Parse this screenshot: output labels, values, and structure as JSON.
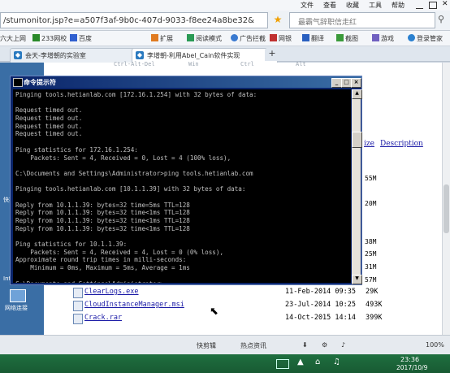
{
  "browser": {
    "menu": [
      "文件",
      "查看",
      "收藏",
      "工具",
      "帮助"
    ],
    "url": "/stumonitor.jsp?e=a507f3af-9b0c-407d-9033-f8ee24a8be32&",
    "search_placeholder": "最霸气辞职信走红",
    "favorites_left": [
      "六大上网",
      "233网校",
      "百度"
    ],
    "toolbar_right": [
      "扩展",
      "阅读模式",
      "广告拦截",
      "网银",
      "翻译",
      "截图",
      "游戏",
      "登录管家"
    ],
    "tabs": [
      {
        "label": "会天-李增朝的实验室",
        "active": false
      },
      {
        "label": "李增朝-利用Abel_Cain软件实现",
        "active": true
      }
    ],
    "shortcut_hints": [
      "Ctrl-Alt-Del",
      "Win",
      "Ctrl",
      "Alt"
    ]
  },
  "page": {
    "header_links": [
      "ize",
      "Description"
    ],
    "desktop_items": [
      "快捷",
      "网络连接",
      "Int"
    ]
  },
  "cmd": {
    "title": "命令提示符",
    "lines": [
      "Pinging tools.hetianlab.com [172.16.1.254] with 32 bytes of data:",
      "",
      "Request timed out.",
      "Request timed out.",
      "Request timed out.",
      "Request timed out.",
      "",
      "Ping statistics for 172.16.1.254:",
      "    Packets: Sent = 4, Received = 0, Lost = 4 (100% loss),",
      "",
      "C:\\Documents and Settings\\Administrator>ping tools.hetianlab.com",
      "",
      "Pinging tools.hetianlab.com [10.1.1.39] with 32 bytes of data:",
      "",
      "Reply from 10.1.1.39: bytes=32 time=5ms TTL=128",
      "Reply from 10.1.1.39: bytes=32 time<1ms TTL=128",
      "Reply from 10.1.1.39: bytes=32 time<1ms TTL=128",
      "Reply from 10.1.1.39: bytes=32 time<1ms TTL=128",
      "",
      "Ping statistics for 10.1.1.39:",
      "    Packets: Sent = 4, Received = 4, Lost = 0 (0% loss),",
      "Approximate round trip times in milli-seconds:",
      "    Minimum = 0ms, Maximum = 5ms, Average = 1ms",
      "",
      "C:\\Documents and Settings\\Administrator>_"
    ]
  },
  "files": [
    {
      "name": "ClearLogs.exe",
      "date": "11-Feb-2014 09:35",
      "size": "29K"
    },
    {
      "name": "CloudInstanceManager.msi",
      "date": "23-Jul-2014 10:25",
      "size": "493K"
    },
    {
      "name": "Crack.rar",
      "date": "14-Oct-2015 14:14",
      "size": "399K"
    }
  ],
  "side_sizes": [
    "55M",
    "20M",
    "38M",
    "25M",
    "31M",
    "57M"
  ],
  "statusbar": {
    "items": [
      "快剪辑",
      "热点资讯",
      "100%"
    ],
    "time": "23:36",
    "date": "2017/10/9"
  },
  "colors": {
    "cmd_bg": "#000000",
    "cmd_text": "#c0c0c0",
    "title_bar": "#0a246a",
    "link": "#1a1aa6",
    "taskbar": "#1f6f3f"
  }
}
